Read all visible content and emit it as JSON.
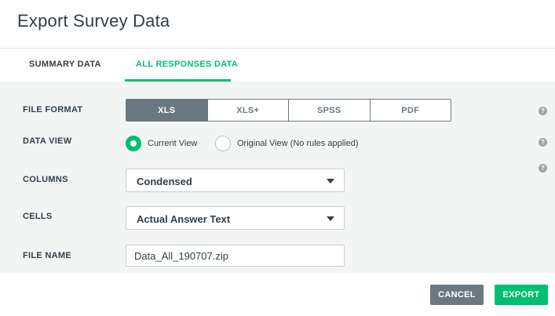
{
  "dialog": {
    "title": "Export Survey Data"
  },
  "tabs": [
    {
      "label": "SUMMARY DATA",
      "active": false
    },
    {
      "label": "ALL RESPONSES DATA",
      "active": true
    }
  ],
  "file_format": {
    "label": "FILE FORMAT",
    "options": [
      "XLS",
      "XLS+",
      "SPSS",
      "PDF"
    ],
    "selected": "XLS"
  },
  "data_view": {
    "label": "DATA VIEW",
    "options": [
      "Current View",
      "Original View (No rules applied)"
    ],
    "selected": "Current View"
  },
  "columns": {
    "label": "COLUMNS",
    "value": "Condensed"
  },
  "cells": {
    "label": "CELLS",
    "value": "Actual Answer Text"
  },
  "file_name": {
    "label": "FILE NAME",
    "value": "Data_All_190707.zip"
  },
  "help_glyph": "?",
  "actions": {
    "cancel_label": "CANCEL",
    "export_label": "EXPORT"
  },
  "colors": {
    "accent": "#00bf6f",
    "neutral": "#6b787f",
    "panel": "#f3f5f5"
  }
}
